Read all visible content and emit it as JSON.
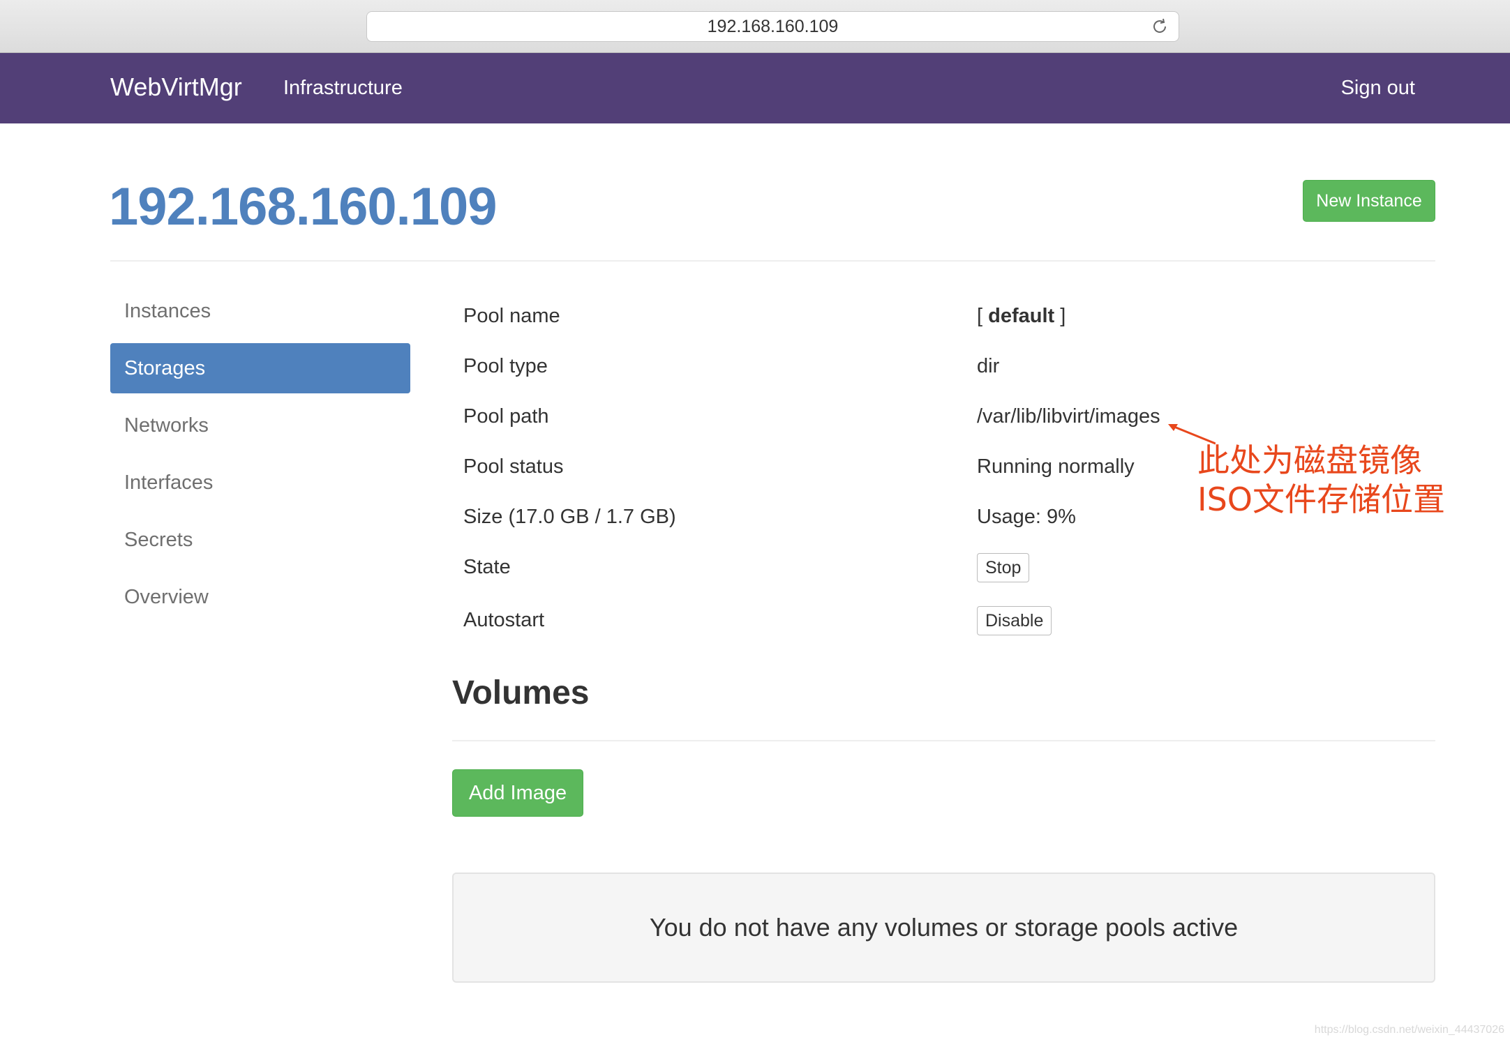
{
  "browser": {
    "url": "192.168.160.109"
  },
  "navbar": {
    "brand": "WebVirtMgr",
    "links": [
      "Infrastructure"
    ],
    "signout": "Sign out"
  },
  "page": {
    "title": "192.168.160.109",
    "new_instance_label": "New Instance"
  },
  "sidebar": {
    "items": [
      {
        "label": "Instances",
        "active": false
      },
      {
        "label": "Storages",
        "active": true
      },
      {
        "label": "Networks",
        "active": false
      },
      {
        "label": "Interfaces",
        "active": false
      },
      {
        "label": "Secrets",
        "active": false
      },
      {
        "label": "Overview",
        "active": false
      }
    ]
  },
  "pool": {
    "name_label": "Pool name",
    "name_value_open": "[ ",
    "name_value": "default",
    "name_value_close": " ]",
    "type_label": "Pool type",
    "type_value": "dir",
    "path_label": "Pool path",
    "path_value": "/var/lib/libvirt/images",
    "status_label": "Pool status",
    "status_value": "Running normally",
    "size_label": "Size (17.0 GB / 1.7 GB)",
    "usage_value": "Usage: 9%",
    "state_label": "State",
    "state_button": "Stop",
    "autostart_label": "Autostart",
    "autostart_button": "Disable"
  },
  "annotation": {
    "line1": "此处为磁盘镜像",
    "line2": "ISO文件存储位置",
    "color": "#e8471c"
  },
  "volumes": {
    "title": "Volumes",
    "add_label": "Add Image",
    "empty_message": "You do not have any volumes or storage pools active"
  },
  "watermark": "https://blog.csdn.net/weixin_44437026",
  "colors": {
    "navbar": "#523f77",
    "primary": "#4f81bd",
    "success": "#5cb85c"
  }
}
